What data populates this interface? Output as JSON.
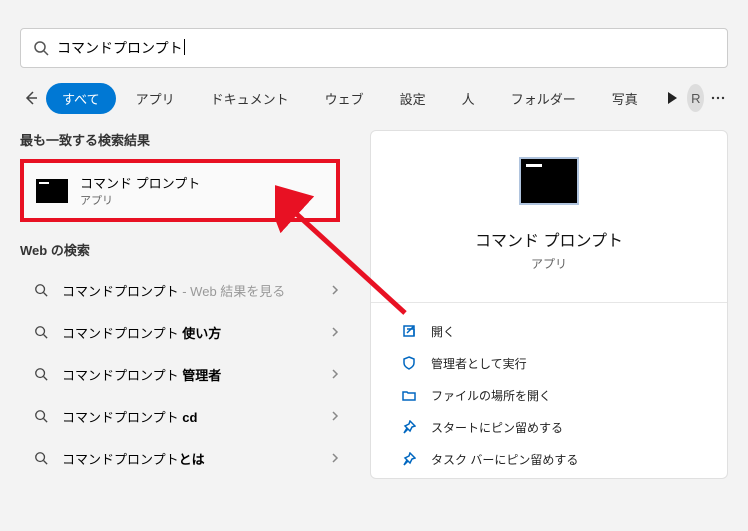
{
  "search": {
    "query": "コマンドプロンプト"
  },
  "tabs": {
    "all": "すべて",
    "app": "アプリ",
    "doc": "ドキュメント",
    "web": "ウェブ",
    "settings": "設定",
    "people": "人",
    "folder": "フォルダー",
    "photo": "写真"
  },
  "avatar_letter": "R",
  "labels": {
    "best_match": "最も一致する検索結果",
    "web_search": "Web の検索"
  },
  "best": {
    "title": "コマンド プロンプト",
    "subtitle": "アプリ"
  },
  "web_results": [
    {
      "prefix": "コマンドプロンプト",
      "suffix": " - Web 結果を見る",
      "suffix_bold": false,
      "suffix_gray": true
    },
    {
      "prefix": "コマンドプロンプト ",
      "suffix": "使い方",
      "suffix_bold": true,
      "suffix_gray": false
    },
    {
      "prefix": "コマンドプロンプト ",
      "suffix": "管理者",
      "suffix_bold": true,
      "suffix_gray": false
    },
    {
      "prefix": "コマンドプロンプト ",
      "suffix": "cd",
      "suffix_bold": true,
      "suffix_gray": false
    },
    {
      "prefix": "コマンドプロンプト",
      "suffix": "とは",
      "suffix_bold": true,
      "suffix_gray": false
    }
  ],
  "preview": {
    "title": "コマンド プロンプト",
    "subtitle": "アプリ"
  },
  "actions": [
    {
      "icon": "open",
      "label": "開く"
    },
    {
      "icon": "admin",
      "label": "管理者として実行"
    },
    {
      "icon": "folder",
      "label": "ファイルの場所を開く"
    },
    {
      "icon": "pin",
      "label": "スタートにピン留めする"
    },
    {
      "icon": "pin",
      "label": "タスク バーにピン留めする"
    }
  ]
}
